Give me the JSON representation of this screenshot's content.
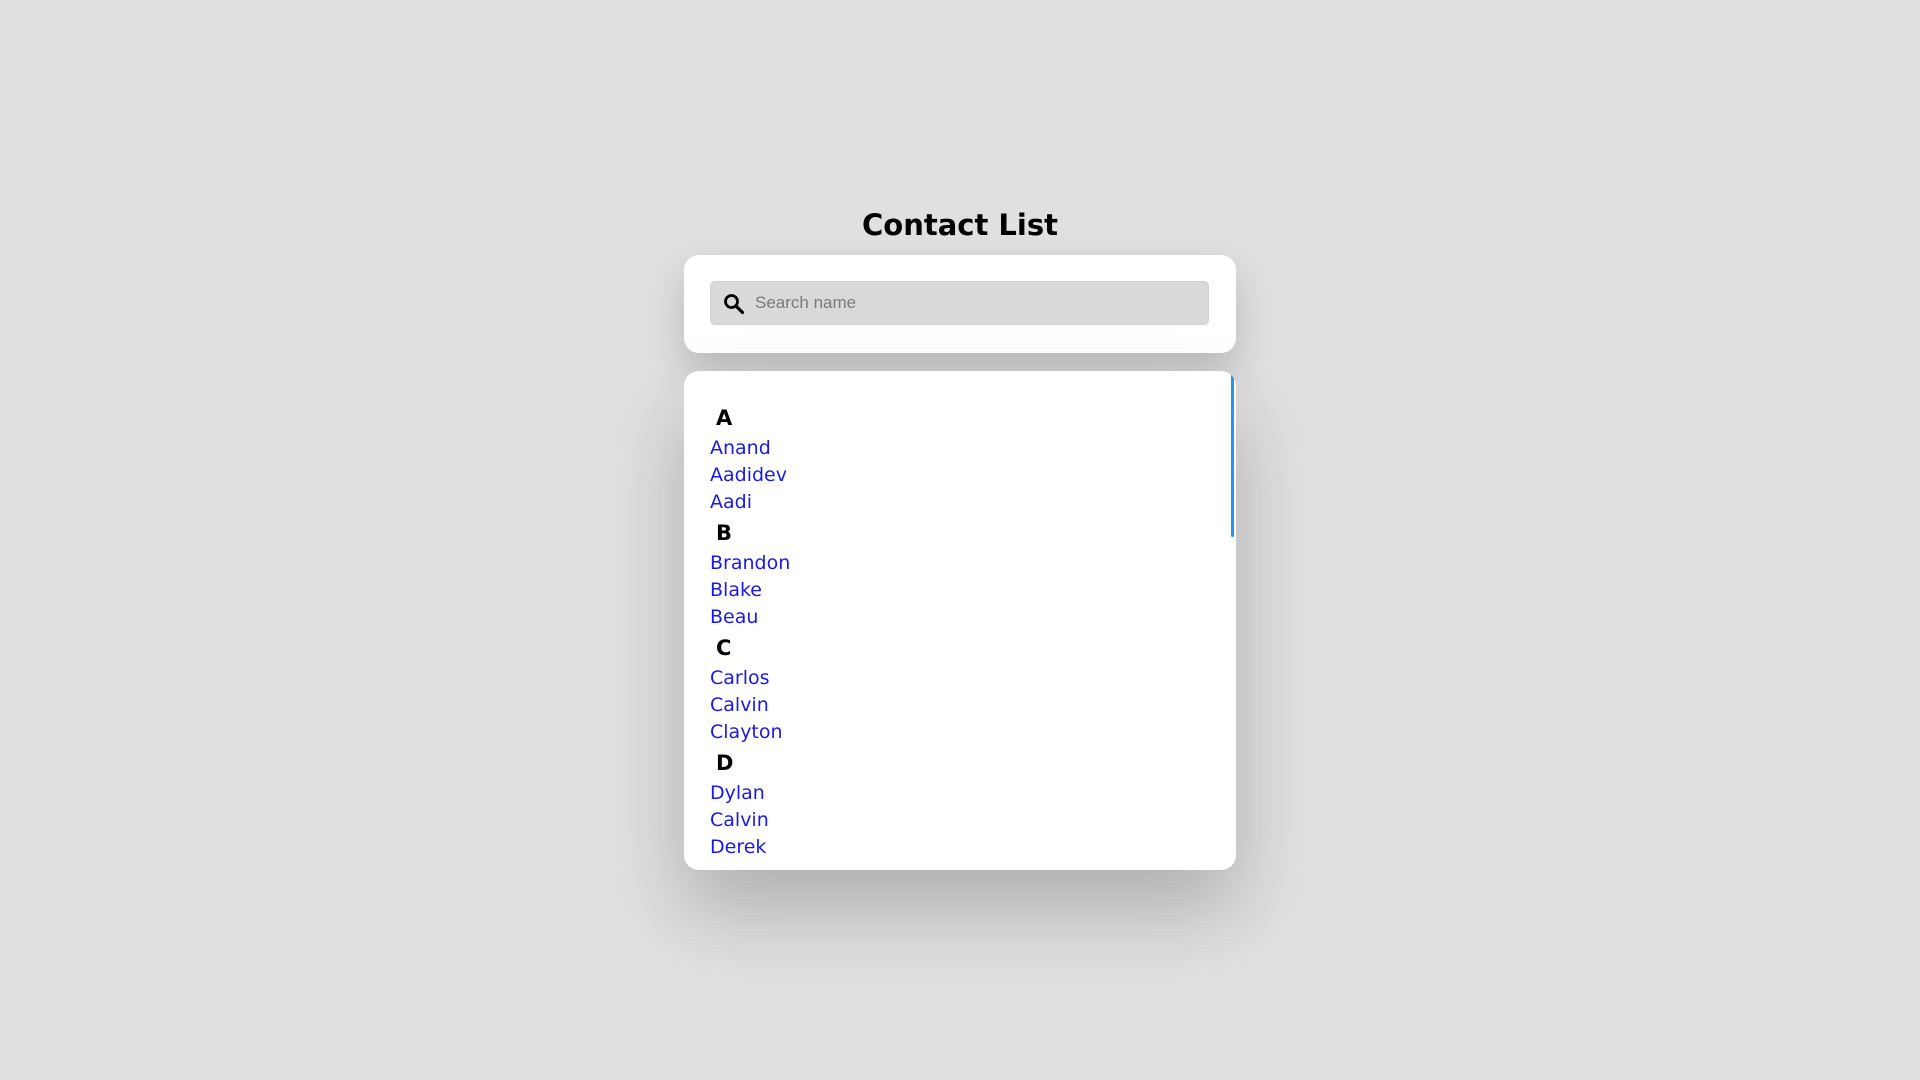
{
  "header": {
    "title": "Contact List"
  },
  "search": {
    "placeholder": "Search name",
    "value": "",
    "icon": "search-icon"
  },
  "sections": [
    {
      "letter": "A",
      "contacts": [
        "Anand",
        "Aadidev",
        "Aadi"
      ]
    },
    {
      "letter": "B",
      "contacts": [
        "Brandon",
        "Blake",
        "Beau"
      ]
    },
    {
      "letter": "C",
      "contacts": [
        "Carlos",
        "Calvin",
        "Clayton"
      ]
    },
    {
      "letter": "D",
      "contacts": [
        "Dylan",
        "Calvin",
        "Derek"
      ]
    }
  ],
  "colors": {
    "background": "#e0e0e0",
    "contact_link": "#1a1ae6",
    "scrollbar": "#2196f3"
  }
}
